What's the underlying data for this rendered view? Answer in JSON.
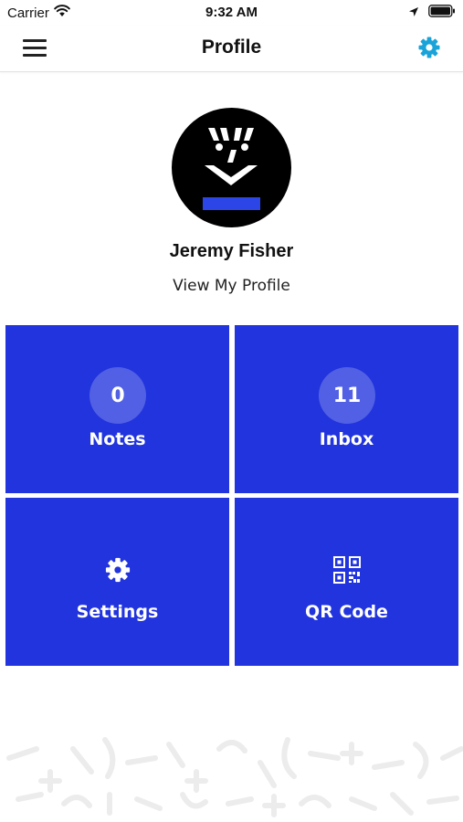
{
  "status_bar": {
    "carrier": "Carrier",
    "time": "9:32 AM",
    "icons": [
      "wifi-icon",
      "location-arrow-icon",
      "battery-icon"
    ]
  },
  "nav": {
    "title": "Profile",
    "menu_icon": "hamburger-menu-icon",
    "settings_icon": "gear-icon",
    "accent_color": "#1aa3d9"
  },
  "profile": {
    "name": "Jeremy Fisher",
    "link_label": "View My Profile"
  },
  "tiles": [
    {
      "label": "Notes",
      "count": "0"
    },
    {
      "label": "Inbox",
      "count": "11"
    },
    {
      "label": "Settings",
      "icon": "gear-icon"
    },
    {
      "label": "QR Code",
      "icon": "qr-code-icon"
    }
  ],
  "colors": {
    "tile_background": "#2134dd",
    "avatar_background": "#000000",
    "avatar_bar": "#2b45e6"
  }
}
